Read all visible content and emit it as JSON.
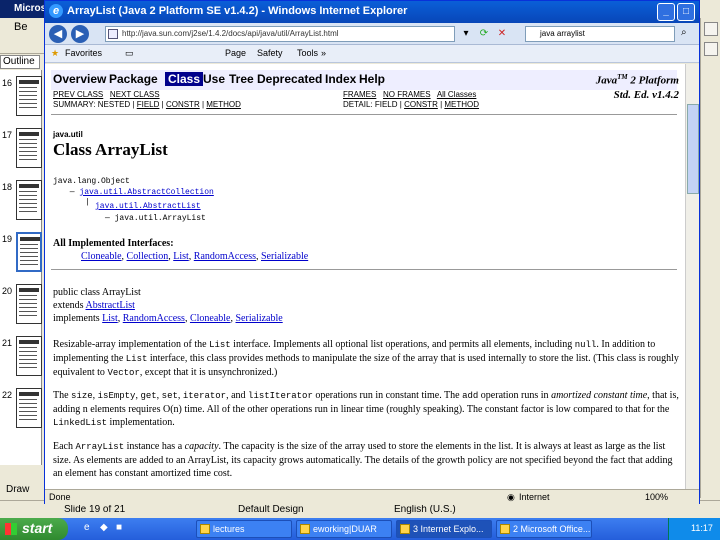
{
  "background_app": {
    "title": "Micros",
    "menu_label": "Be",
    "outline_tab": "Outline",
    "slide_numbers": [
      "16",
      "17",
      "18",
      "19",
      "20",
      "21",
      "22"
    ],
    "draw_label": "Draw",
    "status": {
      "slide": "Slide 19 of 21",
      "design": "Default Design",
      "language": "English (U.S.)"
    }
  },
  "browser": {
    "title": "ArrayList (Java 2 Platform SE v1.4.2) - Windows Internet Explorer",
    "url": "http://java.sun.com/j2se/1.4.2/docs/api/java/util/ArrayList.html",
    "search_value": "java arraylist",
    "favorites_label": "Favorites",
    "commands": {
      "page": "Page",
      "safety": "Safety",
      "tools": "Tools"
    },
    "status_left": "Done",
    "status_zone": "Internet",
    "zoom": "100%"
  },
  "javadoc": {
    "navbar": [
      "Overview",
      "Package",
      "Class",
      "Use",
      "Tree",
      "Deprecated",
      "Index",
      "Help"
    ],
    "platform_line1": "Java",
    "platform_tm": "TM",
    "platform_line1b": " 2 Platform",
    "platform_line2": "Std. Ed. v1.4.2",
    "prev_class": "PREV CLASS",
    "next_class": "NEXT CLASS",
    "frames": "FRAMES",
    "no_frames": "NO FRAMES",
    "all_classes": "All Classes",
    "summary_prefix": "SUMMARY: NESTED | ",
    "field": "FIELD",
    "constr": "CONSTR",
    "method": "METHOD",
    "detail_prefix": "DETAIL: FIELD | ",
    "package": "java.util",
    "class_title": "Class ArrayList",
    "tree": [
      "java.lang.Object",
      "java.util.AbstractCollection",
      "java.util.AbstractList",
      "java.util.ArrayList"
    ],
    "interfaces_heading": "All Implemented Interfaces:",
    "interfaces": [
      "Cloneable",
      "Collection",
      "List",
      "RandomAccess",
      "Serializable"
    ],
    "decl_line1": "public class ArrayList",
    "decl_extends": "extends ",
    "decl_super": "AbstractList",
    "decl_implements": "implements ",
    "decl_impls": [
      "List",
      "RandomAccess",
      "Cloneable",
      "Serializable"
    ],
    "para1": {
      "a": "Resizable-array implementation of the ",
      "b": "List",
      "c": " interface. Implements all optional list operations, and permits all elements, including ",
      "d": "null",
      "e": ". In addition to implementing the ",
      "f": "List",
      "g": " interface, this class provides methods to manipulate the size of the array that is used internally to store the list. (This class is roughly equivalent to ",
      "h": "Vector",
      "i": ", except that it is unsynchronized.)"
    },
    "para2": {
      "a": "The ",
      "b": "size",
      "c": ", ",
      "d": "isEmpty",
      "e": ", ",
      "f": "get",
      "g": ", ",
      "h": "set",
      "i": ", ",
      "j": "iterator",
      "k": ", and ",
      "l": "listIterator",
      "m": " operations run in constant time. The ",
      "n": "add",
      "o": " operation runs in ",
      "p": "amortized constant time",
      "q": ", that is, adding n elements requires O(n) time. All of the other operations run in linear time (roughly speaking). The constant factor is low compared to that for the ",
      "r": "LinkedList",
      "s": " implementation."
    },
    "para3": {
      "a": "Each ",
      "b": "ArrayList",
      "c": " instance has a ",
      "d": "capacity",
      "e": ". The capacity is the size of the array used to store the elements in the list. It is always at least as large as the list size. As elements are added to an ArrayList, its capacity grows automatically. The details of the growth policy are not specified beyond the fact that adding an element has constant amortized time cost."
    }
  },
  "taskbar": {
    "start": "start",
    "buttons": [
      "lectures",
      "eworking|DUAR",
      "3 Internet Explo...",
      "2 Microsoft Office..."
    ],
    "clock": "11:17"
  }
}
